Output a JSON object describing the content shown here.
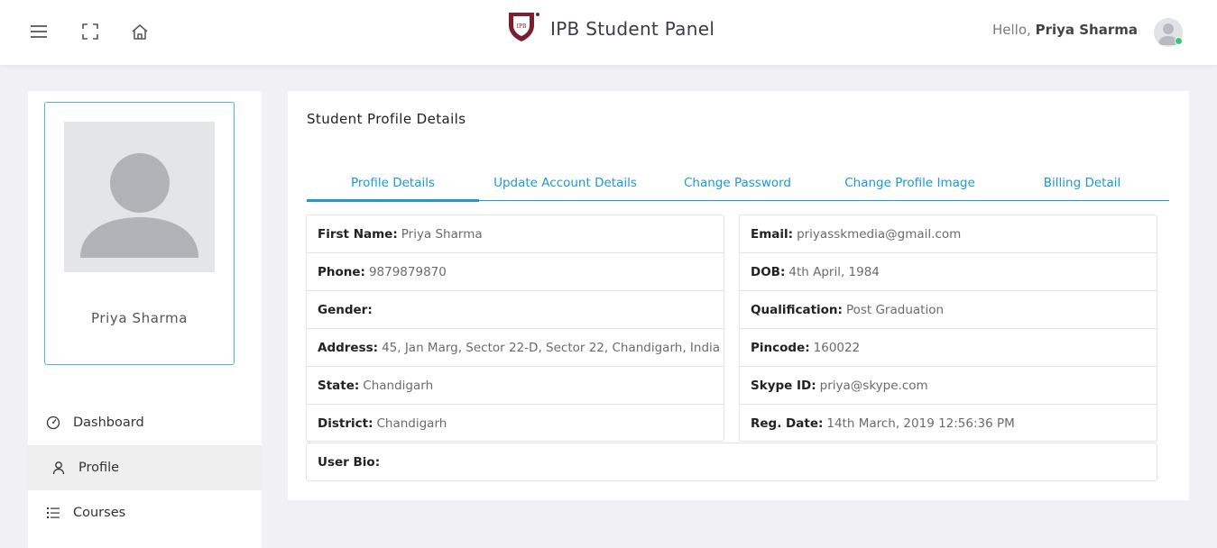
{
  "header": {
    "app_title": "IPB Student Panel",
    "logo_text": "IPB",
    "greeting_prefix": "Hello,",
    "user_name": "Priya Sharma",
    "icons": [
      "menu-icon",
      "fullscreen-icon",
      "home-icon"
    ],
    "online_status_color": "#2ecc71"
  },
  "sidebar": {
    "profile_name": "Priya Sharma",
    "menu": [
      {
        "label": "Dashboard",
        "icon": "speedometer-icon",
        "active": false
      },
      {
        "label": "Profile",
        "icon": "user-icon",
        "active": true
      },
      {
        "label": "Courses",
        "icon": "list-icon",
        "active": false
      }
    ]
  },
  "main": {
    "title": "Student Profile Details",
    "tabs": [
      {
        "label": "Profile Details",
        "active": true
      },
      {
        "label": "Update Account Details",
        "active": false
      },
      {
        "label": "Change Password",
        "active": false
      },
      {
        "label": "Change Profile Image",
        "active": false
      },
      {
        "label": "Billing Detail",
        "active": false
      }
    ],
    "left_details": [
      {
        "label": "First Name:",
        "value": "Priya Sharma"
      },
      {
        "label": "Phone:",
        "value": "9879879870"
      },
      {
        "label": "Gender:",
        "value": ""
      },
      {
        "label": "Address:",
        "value": "45, Jan Marg, Sector 22-D, Sector 22, Chandigarh, India"
      },
      {
        "label": "State:",
        "value": "Chandigarh"
      },
      {
        "label": "District:",
        "value": "Chandigarh"
      }
    ],
    "right_details": [
      {
        "label": "Email:",
        "value": "priyasskmedia@gmail.com"
      },
      {
        "label": "DOB:",
        "value": "4th April, 1984"
      },
      {
        "label": "Qualification:",
        "value": "Post Graduation"
      },
      {
        "label": "Pincode:",
        "value": "160022"
      },
      {
        "label": "Skype ID:",
        "value": "priya@skype.com"
      },
      {
        "label": "Reg. Date:",
        "value": "14th March, 2019 12:56:36 PM"
      }
    ],
    "bio_label": "User Bio:",
    "bio_value": ""
  },
  "colors": {
    "accent": "#1a9ad6",
    "brand": "#7b1e2e",
    "background": "#f1f1f5"
  }
}
